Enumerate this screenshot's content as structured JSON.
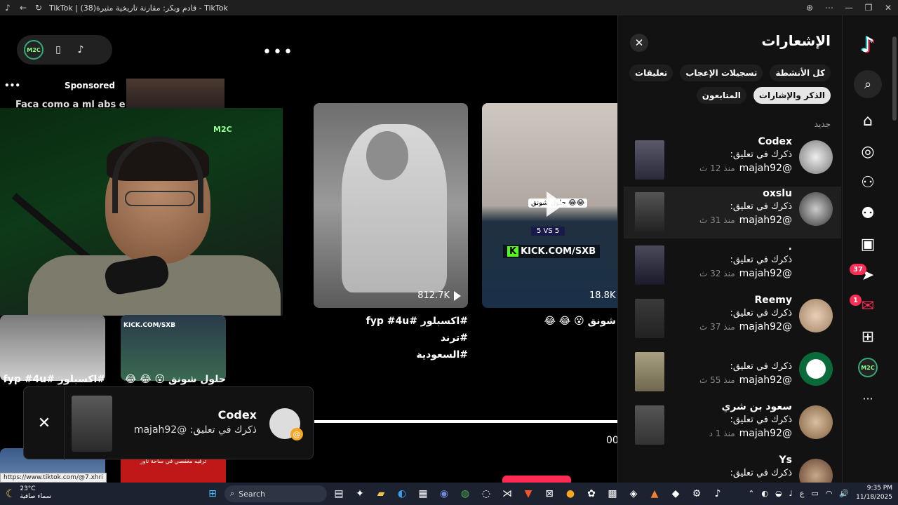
{
  "browser": {
    "title": "TikTok | قادم وبكر: مقارنة تاريخية مثيرة(38) - TikTok"
  },
  "stage": {
    "sponsored_label": "Sponsored",
    "sponsored_caption": "Faca como a ml abs e",
    "logo_text": "M2C",
    "webcam_wall_text": "M2C",
    "cards": [
      {
        "views": "812.7K",
        "caption_line1": "#اكسبلور #fyp #4u #ترند",
        "caption_line2": "#السعودية"
      },
      {
        "views": "18.8K",
        "caption": "شونق 😮 😂 😂",
        "kick": "KICK.COM/SXB",
        "score": "5 VS 5",
        "overlay": "حلول شونق 😂😂"
      }
    ],
    "lower_captions": [
      "#اكسبلور #fyp #4u",
      "حلول شونق 😮 😂 😂"
    ],
    "lower_kick": "KICK.COM/SXB",
    "bottom_thumb_text": "ترفيه مغفصي في ساحة ناور",
    "progress_time": "00"
  },
  "toast": {
    "name": "Codex",
    "message": "ذكرك في تعليق: @majah92",
    "close": "✕"
  },
  "panel": {
    "title": "الإشعارات",
    "close": "✕",
    "chips": [
      {
        "label": "كل الأنشطة",
        "active": false
      },
      {
        "label": "تسجيلات الإعجاب",
        "active": false
      },
      {
        "label": "تعليقات",
        "active": false
      },
      {
        "label": "الذكر والإشارات",
        "active": true
      },
      {
        "label": "المتابعون",
        "active": false
      }
    ],
    "section_new": "جديد",
    "items": [
      {
        "name": "Codex",
        "line": "ذكرك في تعليق:",
        "handle": "@majah92",
        "time": "منذ 12 ث"
      },
      {
        "name": "oxslu",
        "line": "ذكرك في تعليق:",
        "handle": "@majah92",
        "time": "منذ 31 ث"
      },
      {
        "name": ".",
        "line": "ذكرك في تعليق:",
        "handle": "@majah92",
        "time": "منذ 32 ث"
      },
      {
        "name": "Reemy",
        "line": "ذكرك في تعليق:",
        "handle": "@majah92",
        "time": "منذ 37 ث"
      },
      {
        "name": "",
        "line": "ذكرك في تعليق:",
        "handle": "@majah92",
        "time": "منذ 55 ث"
      },
      {
        "name": "سعود بن شري",
        "line": "ذكرك في تعليق:",
        "handle": "@majah92",
        "time": "منذ 1 د"
      },
      {
        "name": "Ys",
        "line": "ذكرك في تعليق:",
        "handle": "",
        "time": ""
      }
    ]
  },
  "rail": {
    "inbox_badge": "37",
    "messages_badge": "1",
    "profile_text": "M2C",
    "more": "···"
  },
  "status_url": "https://www.tiktok.com/@7.xhri",
  "taskbar": {
    "temp": "23°C",
    "weather": "سماء صافية",
    "search": "Search",
    "time": "9:35 PM",
    "date": "11/18/2025",
    "lang": "ع"
  }
}
